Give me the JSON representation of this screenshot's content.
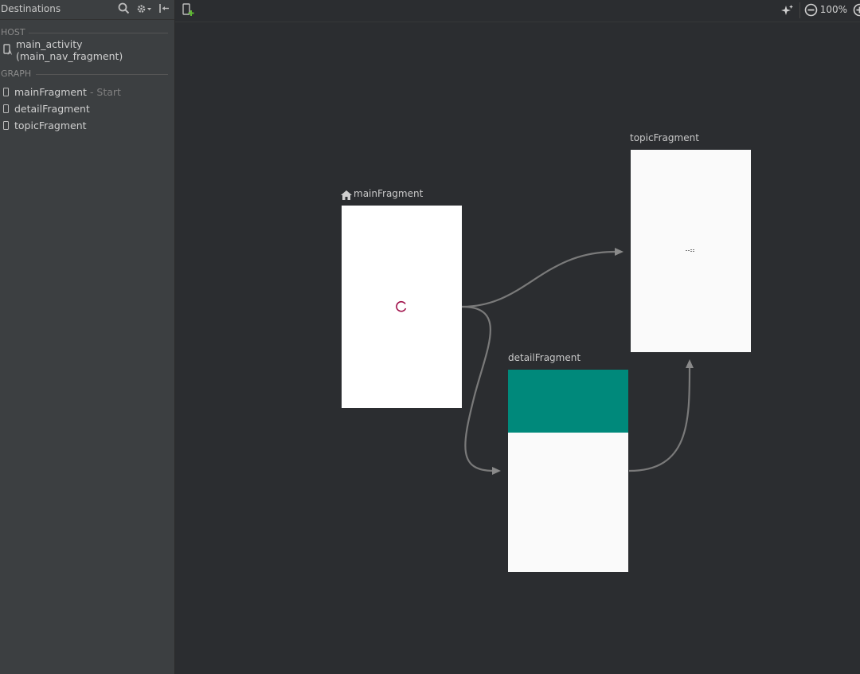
{
  "sidebar": {
    "title": "Destinations",
    "host_label": "HOST",
    "host_item": "main_activity (main_nav_fragment)",
    "graph_label": "GRAPH",
    "graph_items": [
      {
        "name": "mainFragment",
        "suffix": " - Start"
      },
      {
        "name": "detailFragment",
        "suffix": ""
      },
      {
        "name": "topicFragment",
        "suffix": ""
      }
    ]
  },
  "toolbar": {
    "zoom": "100%"
  },
  "graph": {
    "main": {
      "label": "mainFragment"
    },
    "detail": {
      "label": "detailFragment",
      "toolbar_color": "#00897b"
    },
    "topic": {
      "label": "topicFragment"
    }
  },
  "colors": {
    "spinner": "#a0104a",
    "arrow": "#7a7a7a",
    "add_icon": "#5fb832"
  },
  "icons": [
    "search-icon",
    "gear-icon",
    "collapse-icon",
    "new-destination-icon",
    "auto-arrange-icon",
    "zoom-out-icon",
    "zoom-in-icon",
    "home-icon",
    "activity-icon",
    "fragment-icon"
  ]
}
